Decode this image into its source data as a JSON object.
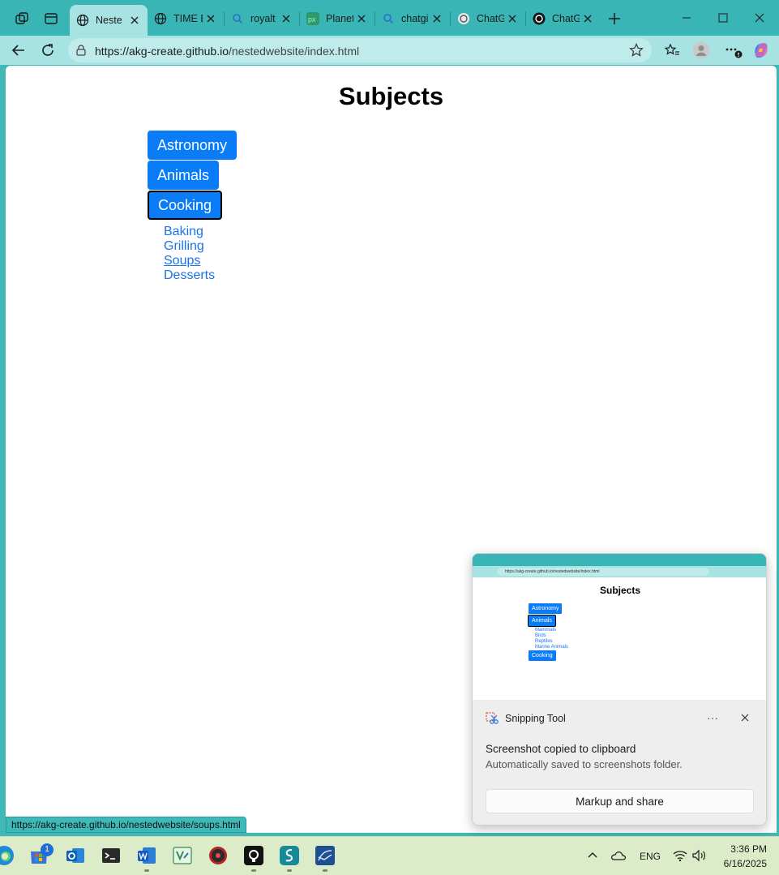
{
  "browser": {
    "tabs": [
      {
        "title": "Neste",
        "icon": "globe-icon",
        "active": true
      },
      {
        "title": "TIME E",
        "icon": "globe-icon"
      },
      {
        "title": "royalt",
        "icon": "search-icon"
      },
      {
        "title": "Planet",
        "icon": "pixel-icon"
      },
      {
        "title": "chatgi",
        "icon": "search-icon"
      },
      {
        "title": "ChatG",
        "icon": "openai-icon"
      },
      {
        "title": "ChatG",
        "icon": "openai-icon"
      }
    ],
    "url_host": "https://akg-create.github.io",
    "url_path": "/nestedwebsite/index.html",
    "status_url": "https://akg-create.github.io/nestedwebsite/soups.html"
  },
  "page": {
    "title": "Subjects",
    "buttons": [
      {
        "label": "Astronomy"
      },
      {
        "label": "Animals"
      },
      {
        "label": "Cooking"
      }
    ],
    "cooking_links": [
      "Baking",
      "Grilling",
      "Soups",
      "Desserts"
    ]
  },
  "toast": {
    "app_name": "Snipping Tool",
    "headline": "Screenshot copied to clipboard",
    "body": "Automatically saved to screenshots folder.",
    "action": "Markup and share",
    "more": "···",
    "thumbnail": {
      "url": "https://akg-create.github.io/nestedwebsite/index.html",
      "title": "Subjects",
      "buttons": [
        "Astronomy",
        "Animals",
        "Cooking"
      ],
      "animal_links": [
        "Mammals",
        "Birds",
        "Reptiles",
        "Marine Animals"
      ]
    }
  },
  "taskbar": {
    "lang": "ENG",
    "time": "3:36 PM",
    "date": "6/16/2025",
    "badge": "1"
  },
  "colors": {
    "tab_strip": "#3ab5b6",
    "toolbar": "#a6e3e2",
    "button_blue": "#0a7cf7",
    "link_blue": "#1a73e8"
  }
}
